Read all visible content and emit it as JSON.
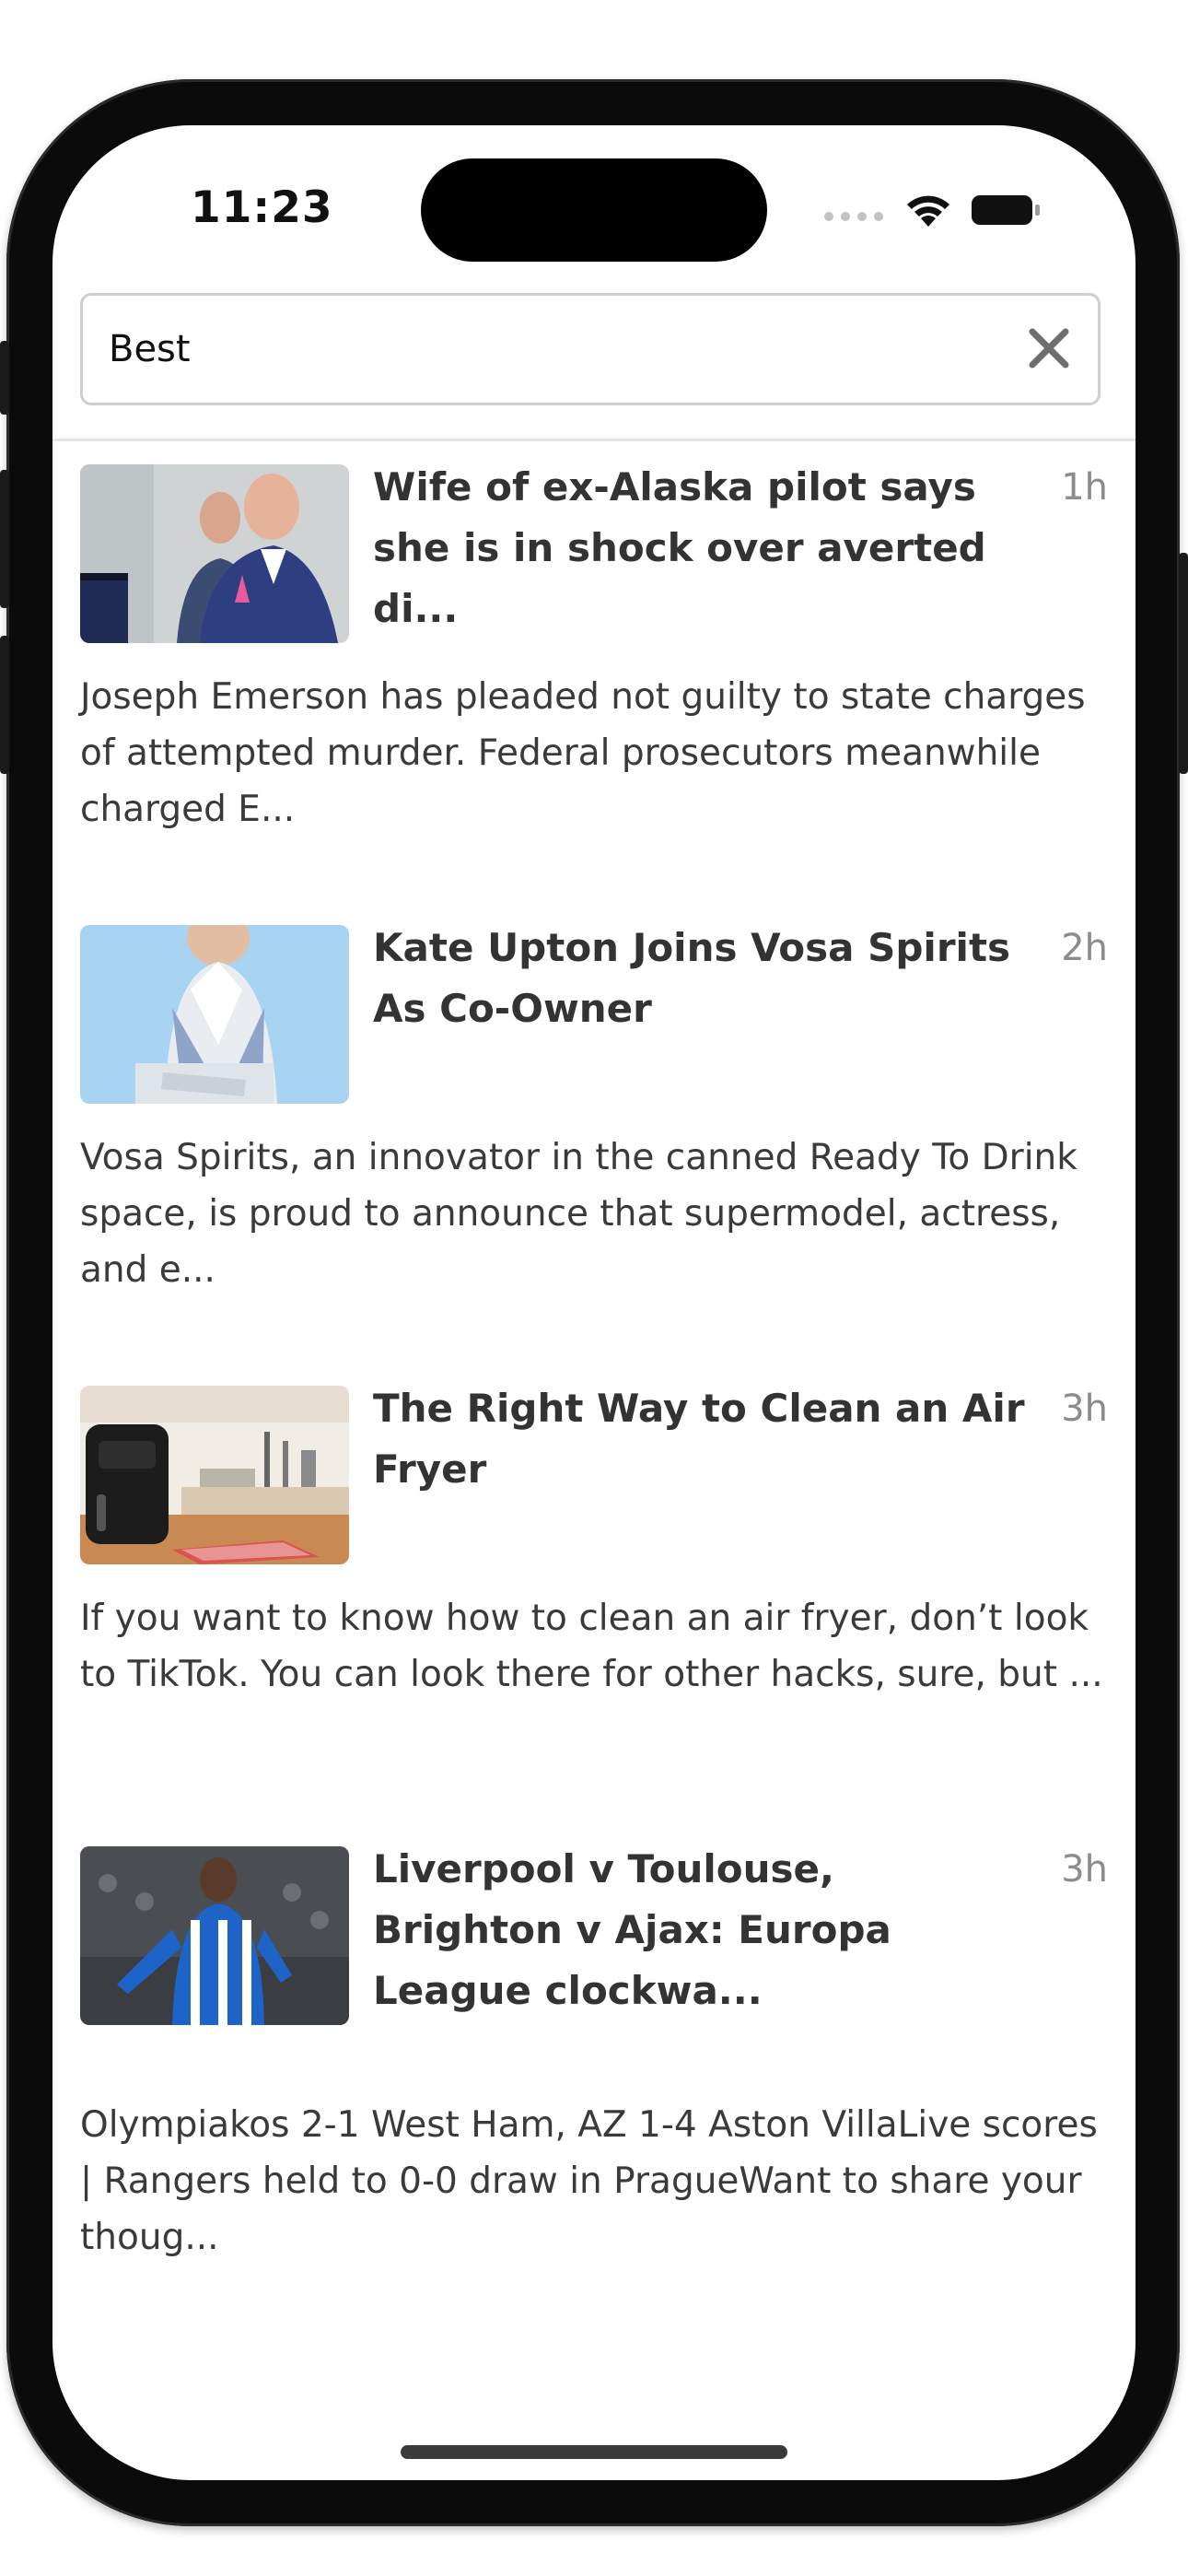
{
  "status_bar": {
    "time": "11:23"
  },
  "search": {
    "value": "Best",
    "clear_icon": "close-icon"
  },
  "articles": [
    {
      "headline": "Wife of ex-Alaska pilot says she is in shock over averted di...",
      "age": "1h",
      "summary": "Joseph Emerson has pleaded not guilty to state charges of attempted murder. Federal prosecutors meanwhile charged E...",
      "thumbnail": "two men in suits photo"
    },
    {
      "headline": "Kate Upton Joins Vosa Spirits As Co-Owner",
      "age": "2h",
      "summary": "Vosa Spirits, an innovator in the canned Ready To Drink space, is proud to announce that supermodel, actress, and e...",
      "thumbnail": "woman in varsity jacket photo"
    },
    {
      "headline": "The Right Way to Clean an Air Fryer",
      "age": "3h",
      "summary": "If you want to know how to clean an air fryer, don’t look to TikTok. You can look there for other hacks, sure, but ...",
      "thumbnail": "air fryer in kitchen photo"
    },
    {
      "headline": "Liverpool v Toulouse, Brighton v Ajax: Europa League clockwa...",
      "age": "3h",
      "summary": "Olympiakos 2-1 West Ham, AZ 1-4 Aston VillaLive scores | Rangers held to 0-0 draw in PragueWant to share your thoug...",
      "thumbnail": "football player celebrating photo"
    }
  ],
  "colors": {
    "headline": "#333333",
    "summary": "#3a3a3a",
    "age": "#8c8c8c",
    "border": "#cfcfcf"
  }
}
